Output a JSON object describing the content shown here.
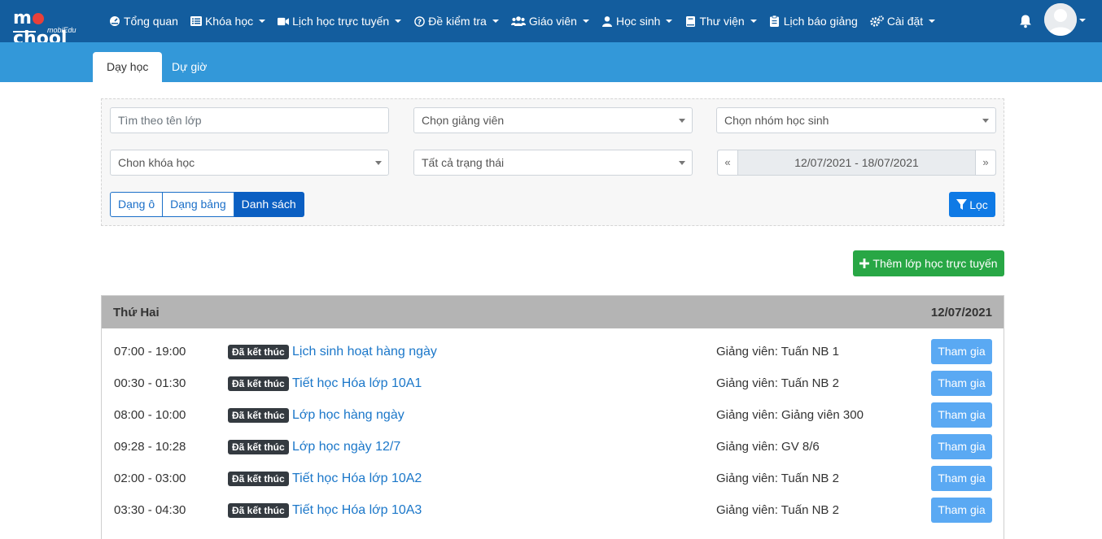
{
  "brand": {
    "logo_main": "m school",
    "logo_sub": "mobiEdu"
  },
  "nav": {
    "items": [
      {
        "label": "Tổng quan",
        "icon": "dashboard-icon",
        "caret": false
      },
      {
        "label": "Khóa học",
        "icon": "list-icon",
        "caret": true
      },
      {
        "label": "Lịch học trực tuyến",
        "icon": "video-icon",
        "caret": true
      },
      {
        "label": "Đề kiểm tra",
        "icon": "question-icon",
        "caret": true
      },
      {
        "label": "Giáo viên",
        "icon": "users-icon",
        "caret": true
      },
      {
        "label": "Học sinh",
        "icon": "user-icon",
        "caret": true
      },
      {
        "label": "Thư viện",
        "icon": "book-icon",
        "caret": true
      },
      {
        "label": "Lịch báo giảng",
        "icon": "clipboard-icon",
        "caret": false
      },
      {
        "label": "Cài đặt",
        "icon": "cogs-icon",
        "caret": true
      }
    ]
  },
  "tabs": {
    "teaching": "Dạy học",
    "observe": "Dự giờ"
  },
  "filters": {
    "search_placeholder": "Tìm theo tên lớp",
    "teacher": "Chọn giảng viên",
    "student_group": "Chọn nhóm học sinh",
    "course": "Chon khóa học",
    "status": "Tất cả trạng thái",
    "date_range": "12/07/2021 - 18/07/2021",
    "prev": "«",
    "next": "»",
    "view_grid": "Dạng ô",
    "view_table": "Dạng bảng",
    "view_list": "Danh sách",
    "filter_button": "Lọc"
  },
  "add_button": "Thêm lớp học trực tuyến",
  "day": {
    "name": "Thứ Hai",
    "date": "12/07/2021",
    "sessions": [
      {
        "time": "07:00 - 19:00",
        "status": "Đã kết thúc",
        "title": "Lịch sinh hoạt hàng ngày",
        "teacher": "Giảng viên: Tuấn NB 1",
        "join": "Tham gia"
      },
      {
        "time": "00:30 - 01:30",
        "status": "Đã kết thúc",
        "title": "Tiết học Hóa lớp 10A1",
        "teacher": "Giảng viên: Tuấn NB 2",
        "join": "Tham gia"
      },
      {
        "time": "08:00 - 10:00",
        "status": "Đã kết thúc",
        "title": "Lớp học hàng ngày",
        "teacher": "Giảng viên: Giảng viên 300",
        "join": "Tham gia"
      },
      {
        "time": "09:28 - 10:28",
        "status": "Đã kết thúc",
        "title": "Lớp học ngày 12/7",
        "teacher": "Giảng viên: GV 8/6",
        "join": "Tham gia"
      },
      {
        "time": "02:00 - 03:00",
        "status": "Đã kết thúc",
        "title": "Tiết học Hóa lớp 10A2",
        "teacher": "Giảng viên: Tuấn NB 2",
        "join": "Tham gia"
      },
      {
        "time": "03:30 - 04:30",
        "status": "Đã kết thúc",
        "title": "Tiết học Hóa lớp 10A3",
        "teacher": "Giảng viên: Tuấn NB 2",
        "join": "Tham gia"
      }
    ]
  }
}
